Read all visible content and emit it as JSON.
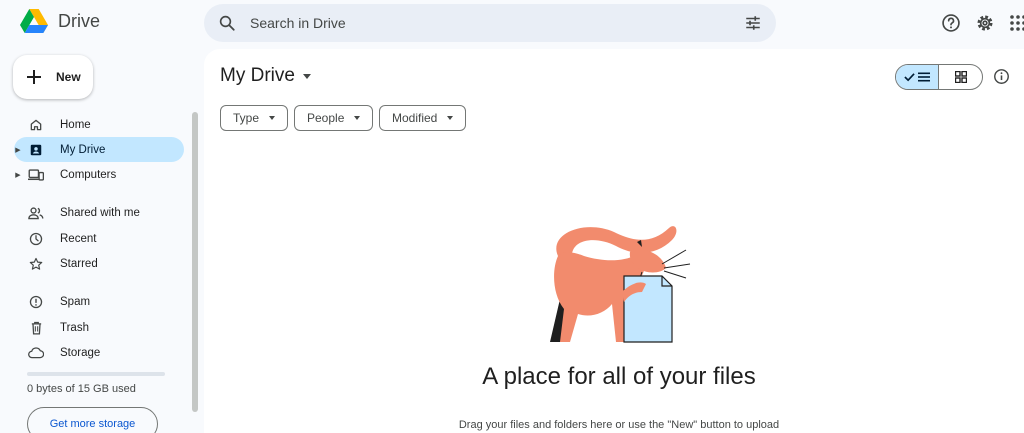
{
  "app": {
    "name": "Drive"
  },
  "search": {
    "placeholder": "Search in Drive"
  },
  "sidebar": {
    "new_label": "New",
    "items": [
      {
        "label": "Home",
        "icon": "home-icon"
      },
      {
        "label": "My Drive",
        "icon": "my-drive-icon",
        "active": true
      },
      {
        "label": "Computers",
        "icon": "computers-icon"
      },
      {
        "label": "Shared with me",
        "icon": "shared-icon"
      },
      {
        "label": "Recent",
        "icon": "clock-icon"
      },
      {
        "label": "Starred",
        "icon": "star-icon"
      },
      {
        "label": "Spam",
        "icon": "spam-icon"
      },
      {
        "label": "Trash",
        "icon": "trash-icon"
      },
      {
        "label": "Storage",
        "icon": "cloud-icon"
      }
    ],
    "storage_text": "0 bytes of 15 GB used",
    "storage_used_fraction": 0,
    "get_storage_label": "Get more storage"
  },
  "main": {
    "title": "My Drive",
    "filters": [
      "Type",
      "People",
      "Modified"
    ],
    "empty_title": "A place for all of your files",
    "empty_subtitle": "Drag your files and folders here or use the \"New\" button to upload"
  },
  "colors": {
    "accent": "#c2e7ff",
    "link": "#0b57d0",
    "search_bg": "#e9eef6",
    "cat": "#f28b6d",
    "doc": "#c2e7ff"
  }
}
